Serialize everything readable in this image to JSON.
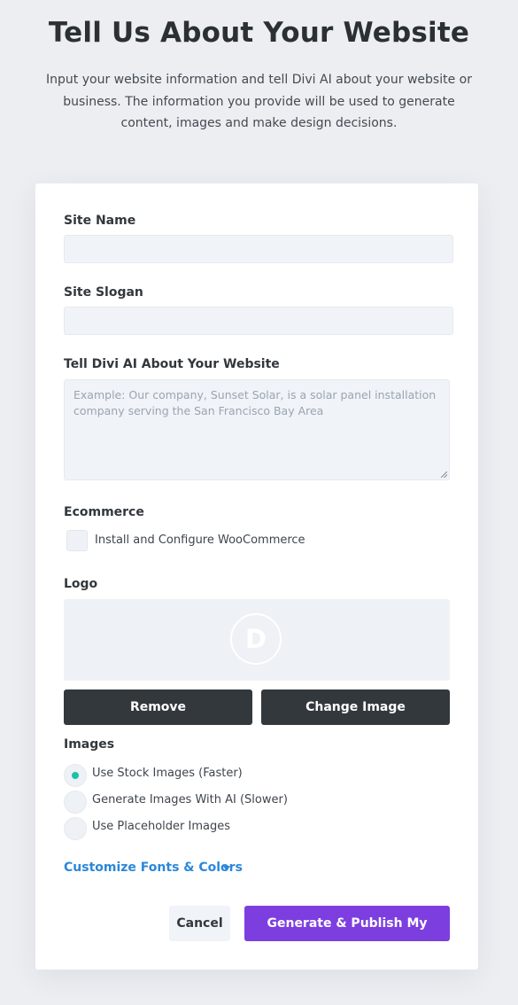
{
  "header": {
    "title": "Tell Us About Your Website",
    "intro": "Input your website information and tell Divi AI about your website or business. The information you provide will be used to generate content, images and make design decisions."
  },
  "form": {
    "site_name": {
      "label": "Site Name",
      "value": "",
      "placeholder": ""
    },
    "site_slogan": {
      "label": "Site Slogan",
      "value": "",
      "placeholder": ""
    },
    "about": {
      "label": "Tell Divi AI About Your Website",
      "placeholder": "Example: Our company, Sunset Solar, is a solar panel installation company serving the San Francisco Bay Area"
    },
    "ecommerce": {
      "label": "Ecommerce",
      "checkbox_label": "Install and Configure WooCommerce",
      "checked": false
    },
    "logo": {
      "label": "Logo",
      "logo_letter": "D",
      "remove_label": "Remove",
      "change_label": "Change Image"
    },
    "images": {
      "label": "Images",
      "selected": "Use Stock Images (Faster)",
      "options": [
        "Use Stock Images (Faster)",
        "Generate Images With AI (Slower)",
        "Use Placeholder Images"
      ]
    },
    "customize_label": "Customize Fonts & Colors",
    "cancel_label": "Cancel",
    "submit_label": "Generate & Publish My Website"
  },
  "icons": {
    "logo": "divi-logo-icon",
    "expand": "caret-down-icon",
    "resize": "resize-grip-icon"
  },
  "colors": {
    "background": "#eceef2",
    "accent_purple": "#7d3ee0",
    "link_blue": "#2b87da",
    "radio_selected": "#20c1a5",
    "dark_button": "#33383d"
  }
}
